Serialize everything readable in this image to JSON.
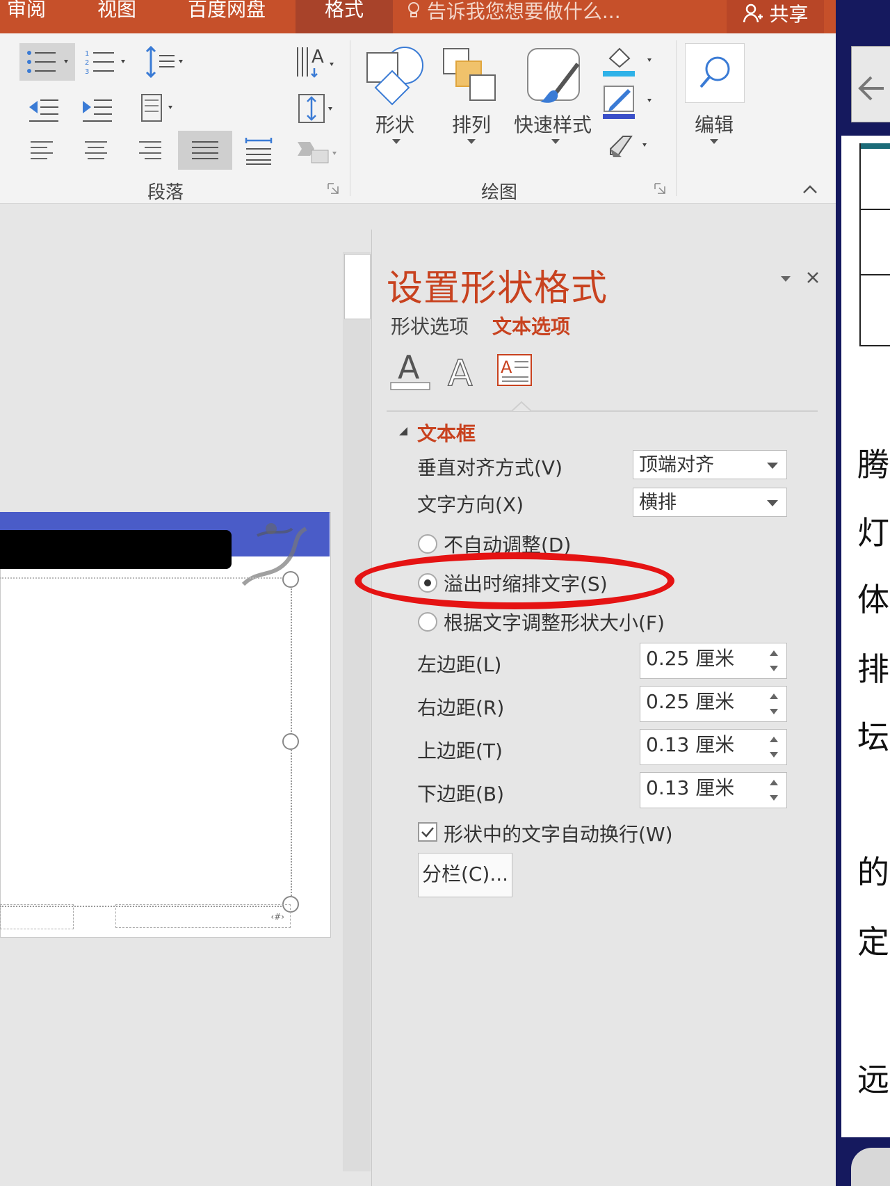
{
  "tabs": [
    "审阅",
    "视图",
    "百度网盘",
    "格式"
  ],
  "tell_me": "告诉我您想要做什么...",
  "share": "共享",
  "ribbon": {
    "groups": {
      "paragraph": "段落",
      "drawing": "绘图"
    },
    "buttons": {
      "shapes": "形状",
      "arrange": "排列",
      "quick_styles": "快速样式",
      "edit": "编辑"
    }
  },
  "pane": {
    "title": "设置形状格式",
    "tabs": {
      "shape_options": "形状选项",
      "text_options": "文本选项"
    },
    "section": "文本框",
    "vertical_align": {
      "label": "垂直对齐方式(V)",
      "value": "顶端对齐"
    },
    "text_direction": {
      "label": "文字方向(X)",
      "value": "横排"
    },
    "radios": {
      "no_autofit": "不自动调整(D)",
      "shrink_on_overflow": "溢出时缩排文字(S)",
      "resize_shape": "根据文字调整形状大小(F)"
    },
    "margins": [
      {
        "label": "左边距(L)",
        "value": "0.25 厘米"
      },
      {
        "label": "右边距(R)",
        "value": "0.25 厘米"
      },
      {
        "label": "上边距(T)",
        "value": "0.13 厘米"
      },
      {
        "label": "下边距(B)",
        "value": "0.13 厘米"
      }
    ],
    "wrap_text": "形状中的文字自动换行(W)",
    "columns_button": "分栏(C)...",
    "annotation_color": "#e51313"
  },
  "slide": {
    "footer_placeholder": "‹#›"
  },
  "doc_chars": [
    "腾",
    "灯",
    "体",
    "排",
    "坛",
    "的",
    "定",
    "远"
  ],
  "colors": {
    "accent": "#c8421f",
    "ribbon_tab": "#c6502a",
    "slide_band": "#4a5cc8",
    "dark_strip": "#15195e"
  }
}
